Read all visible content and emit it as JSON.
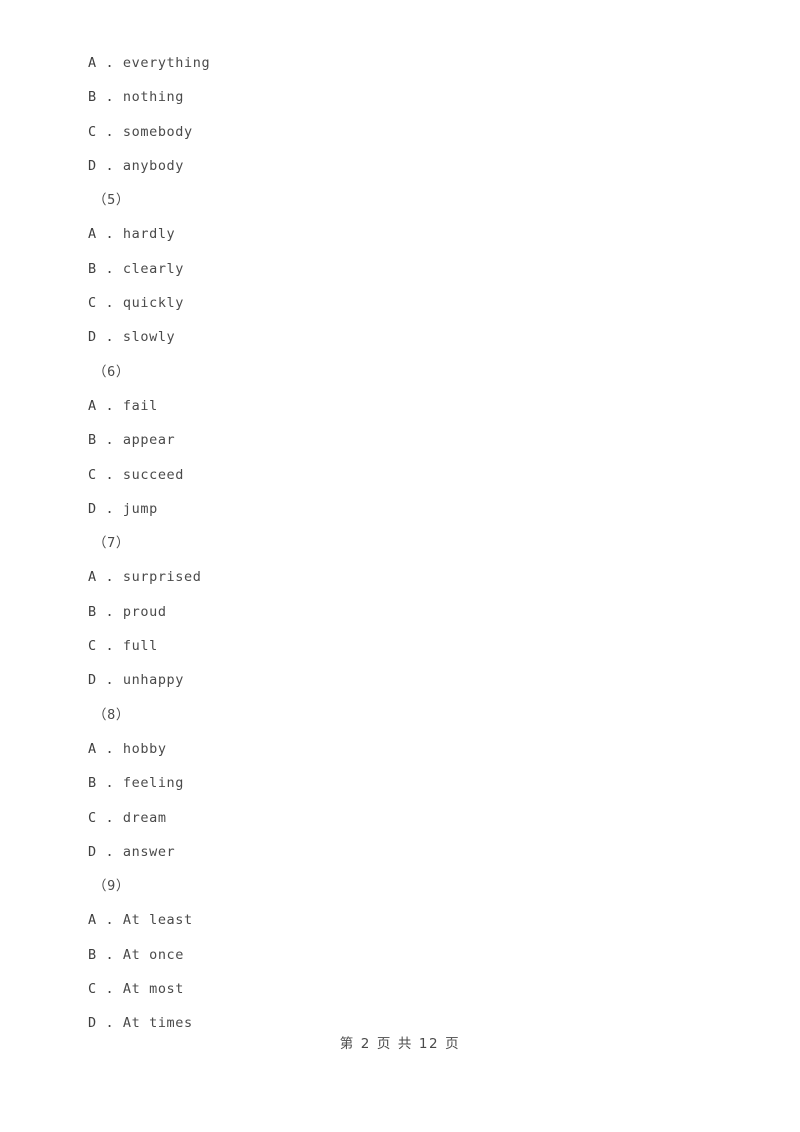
{
  "page": {
    "background_color": "#ffffff",
    "text_color": "#4a4a4a"
  },
  "questions": [
    {
      "number": "（5）",
      "options": [
        {
          "letter": "A",
          "separator": " . ",
          "text": "hardly"
        },
        {
          "letter": "B",
          "separator": " . ",
          "text": "clearly"
        },
        {
          "letter": "C",
          "separator": " . ",
          "text": "quickly"
        },
        {
          "letter": "D",
          "separator": " . ",
          "text": "slowly"
        }
      ]
    },
    {
      "number": "（6）",
      "options": [
        {
          "letter": "A",
          "separator": " . ",
          "text": "fail"
        },
        {
          "letter": "B",
          "separator": " . ",
          "text": "appear"
        },
        {
          "letter": "C",
          "separator": " . ",
          "text": "succeed"
        },
        {
          "letter": "D",
          "separator": " . ",
          "text": "jump"
        }
      ]
    },
    {
      "number": "（7）",
      "options": [
        {
          "letter": "A",
          "separator": " . ",
          "text": "surprised"
        },
        {
          "letter": "B",
          "separator": " . ",
          "text": "proud"
        },
        {
          "letter": "C",
          "separator": " . ",
          "text": "full"
        },
        {
          "letter": "D",
          "separator": " . ",
          "text": "unhappy"
        }
      ]
    },
    {
      "number": "（8）",
      "options": [
        {
          "letter": "A",
          "separator": " . ",
          "text": "hobby"
        },
        {
          "letter": "B",
          "separator": " . ",
          "text": "feeling"
        },
        {
          "letter": "C",
          "separator": " . ",
          "text": "dream"
        },
        {
          "letter": "D",
          "separator": " . ",
          "text": "answer"
        }
      ]
    },
    {
      "number": "（9）",
      "options": [
        {
          "letter": "A",
          "separator": " . ",
          "text": "At least"
        },
        {
          "letter": "B",
          "separator": " . ",
          "text": "At once"
        },
        {
          "letter": "C",
          "separator": " . ",
          "text": "At most"
        },
        {
          "letter": "D",
          "separator": " . ",
          "text": "At times"
        }
      ]
    }
  ],
  "leading_options": [
    {
      "letter": "A",
      "separator": " . ",
      "text": "everything"
    },
    {
      "letter": "B",
      "separator": " . ",
      "text": "nothing"
    },
    {
      "letter": "C",
      "separator": " . ",
      "text": "somebody"
    },
    {
      "letter": "D",
      "separator": " . ",
      "text": "anybody"
    }
  ],
  "footer": {
    "text": "第 2 页 共 12 页",
    "current_page": "2",
    "total_pages": "12"
  }
}
